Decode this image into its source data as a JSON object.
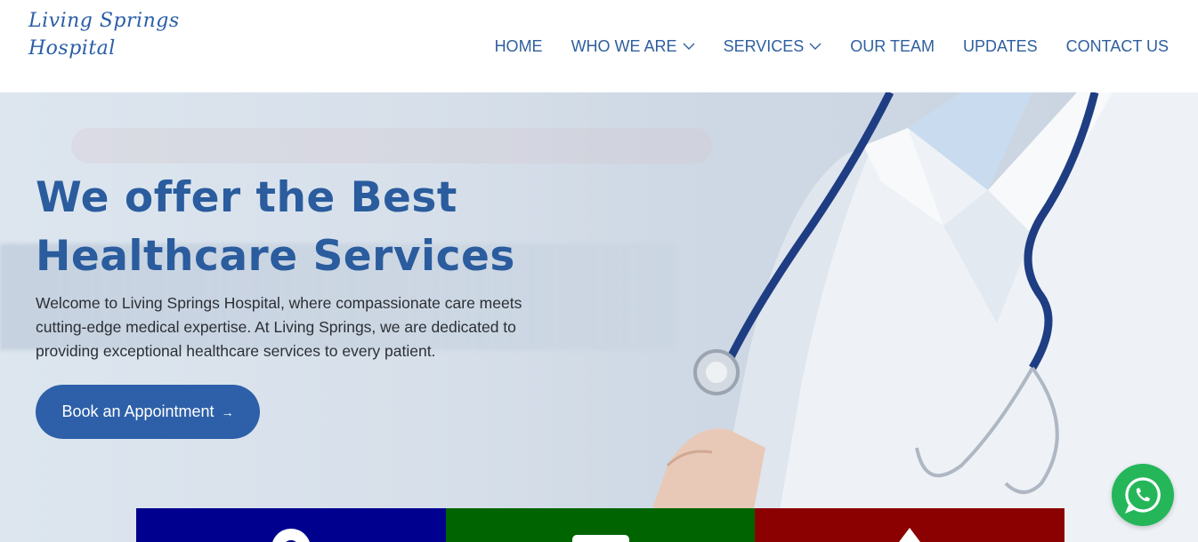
{
  "logo": {
    "line1": "Living Springs",
    "line2": "Hospital"
  },
  "nav": {
    "items": [
      {
        "label": "HOME",
        "dropdown": false
      },
      {
        "label": "WHO WE ARE",
        "dropdown": true
      },
      {
        "label": "SERVICES",
        "dropdown": true
      },
      {
        "label": "OUR TEAM",
        "dropdown": false
      },
      {
        "label": "UPDATES",
        "dropdown": false
      },
      {
        "label": "CONTACT US",
        "dropdown": false
      }
    ]
  },
  "hero": {
    "title_line1": "We offer the Best",
    "title_line2": "Healthcare Services",
    "text": "Welcome to Living Springs Hospital, where compassionate care meets cutting-edge medical expertise. At Living Springs, we are dedicated to providing exceptional healthcare services to every patient.",
    "cta_label": "Book an Appointment",
    "cta_arrow": "→"
  },
  "features": [
    {
      "color": "#00008f",
      "icon": "location-pin-icon"
    },
    {
      "color": "#006400",
      "icon": "envelope-icon"
    },
    {
      "color": "#8b0000",
      "icon": "phone-icon"
    }
  ],
  "whatsapp": {
    "icon": "whatsapp-icon",
    "color": "#25b65a"
  },
  "colors": {
    "brand": "#2d60a8",
    "nav": "#2f5f9e",
    "title": "#2a5c9e"
  }
}
